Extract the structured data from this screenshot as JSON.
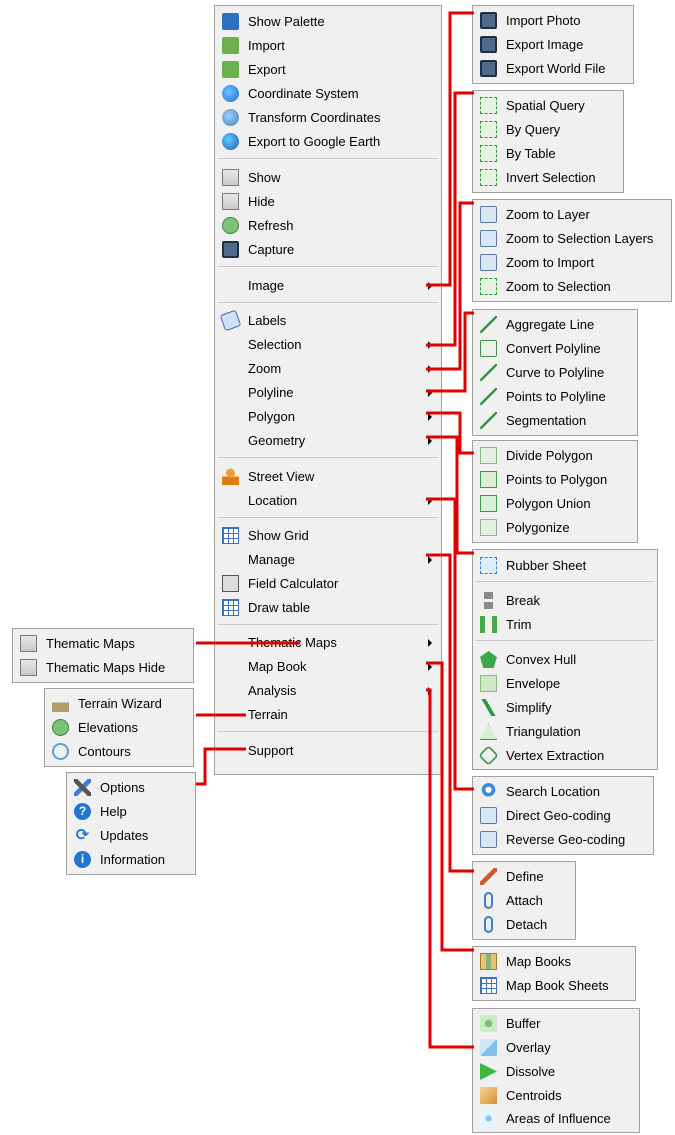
{
  "main_menu": {
    "group1": [
      {
        "label": "Show Palette",
        "icon": "palette-icon"
      },
      {
        "label": "Import",
        "icon": "import-icon"
      },
      {
        "label": "Export",
        "icon": "export-icon"
      },
      {
        "label": "Coordinate System",
        "icon": "globe-icon"
      },
      {
        "label": "Transform Coordinates",
        "icon": "transform-globe-icon"
      },
      {
        "label": "Export to Google Earth",
        "icon": "google-earth-icon"
      }
    ],
    "group2": [
      {
        "label": "Show",
        "icon": "show-icon"
      },
      {
        "label": "Hide",
        "icon": "hide-icon"
      },
      {
        "label": "Refresh",
        "icon": "refresh-icon"
      },
      {
        "label": "Capture",
        "icon": "camera-icon"
      }
    ],
    "group3": [
      {
        "label": "Image"
      }
    ],
    "group4": [
      {
        "label": "Labels",
        "icon": "labels-icon"
      },
      {
        "label": "Selection"
      },
      {
        "label": "Zoom"
      },
      {
        "label": "Polyline"
      },
      {
        "label": "Polygon"
      },
      {
        "label": "Geometry"
      }
    ],
    "group5": [
      {
        "label": "Street View",
        "icon": "street-view-icon"
      },
      {
        "label": "Location"
      }
    ],
    "group6": [
      {
        "label": "Show Grid",
        "icon": "grid-icon"
      },
      {
        "label": "Manage"
      },
      {
        "label": "Field Calculator",
        "icon": "calculator-icon"
      },
      {
        "label": "Draw table",
        "icon": "draw-table-icon"
      }
    ],
    "group7": [
      {
        "label": "Thematic Maps"
      },
      {
        "label": "Map Book"
      },
      {
        "label": "Analysis"
      },
      {
        "label": "Terrain"
      }
    ],
    "group8": [
      {
        "label": "Support"
      }
    ]
  },
  "submenus": {
    "image": [
      {
        "label": "Import Photo",
        "icon": "import-photo-icon"
      },
      {
        "label": "Export Image",
        "icon": "export-image-icon"
      },
      {
        "label": "Export World File",
        "icon": "export-world-file-icon"
      }
    ],
    "selection": [
      {
        "label": "Spatial Query",
        "icon": "spatial-query-icon"
      },
      {
        "label": "By Query",
        "icon": "by-query-icon"
      },
      {
        "label": "By Table",
        "icon": "by-table-icon"
      },
      {
        "label": "Invert Selection",
        "icon": "invert-selection-icon"
      }
    ],
    "zoom": [
      {
        "label": "Zoom to Layer",
        "icon": "zoom-layer-icon"
      },
      {
        "label": "Zoom to Selection Layers",
        "icon": "zoom-selection-layers-icon"
      },
      {
        "label": "Zoom to Import",
        "icon": "zoom-import-icon"
      },
      {
        "label": "Zoom to Selection",
        "icon": "zoom-selection-icon"
      }
    ],
    "polyline": [
      {
        "label": "Aggregate Line",
        "icon": "aggregate-line-icon"
      },
      {
        "label": "Convert Polyline",
        "icon": "convert-2d-3d-icon"
      },
      {
        "label": "Curve to Polyline",
        "icon": "curve-icon"
      },
      {
        "label": "Points to Polyline",
        "icon": "points-polyline-icon"
      },
      {
        "label": "Segmentation",
        "icon": "segmentation-icon"
      }
    ],
    "polygon": [
      {
        "label": "Divide Polygon",
        "icon": "divide-polygon-icon"
      },
      {
        "label": "Points to Polygon",
        "icon": "points-polygon-icon"
      },
      {
        "label": "Polygon Union",
        "icon": "polygon-union-icon"
      },
      {
        "label": "Polygonize",
        "icon": "polygonize-icon"
      }
    ],
    "geometry_a": [
      {
        "label": "Rubber Sheet",
        "icon": "rubber-sheet-icon"
      }
    ],
    "geometry_b": [
      {
        "label": "Break",
        "icon": "break-icon"
      },
      {
        "label": "Trim",
        "icon": "trim-icon"
      }
    ],
    "geometry_c": [
      {
        "label": "Convex Hull",
        "icon": "convex-hull-icon"
      },
      {
        "label": "Envelope",
        "icon": "envelope-icon"
      },
      {
        "label": "Simplify",
        "icon": "simplify-icon"
      },
      {
        "label": "Triangulation",
        "icon": "triangulation-icon"
      },
      {
        "label": "Vertex Extraction",
        "icon": "vertex-extraction-icon"
      }
    ],
    "location": [
      {
        "label": "Search Location",
        "icon": "search-location-icon"
      },
      {
        "label": "Direct Geo-coding",
        "icon": "direct-geocoding-icon"
      },
      {
        "label": "Reverse Geo-coding",
        "icon": "reverse-geocoding-icon"
      }
    ],
    "manage": [
      {
        "label": "Define",
        "icon": "pencil-icon"
      },
      {
        "label": "Attach",
        "icon": "paperclip-icon"
      },
      {
        "label": "Detach",
        "icon": "detach-icon"
      }
    ],
    "map_book": [
      {
        "label": "Map Books",
        "icon": "map-books-icon"
      },
      {
        "label": "Map Book Sheets",
        "icon": "map-book-sheets-icon"
      }
    ],
    "analysis": [
      {
        "label": "Buffer",
        "icon": "buffer-icon"
      },
      {
        "label": "Overlay",
        "icon": "overlay-icon"
      },
      {
        "label": "Dissolve",
        "icon": "dissolve-icon"
      },
      {
        "label": "Centroids",
        "icon": "centroids-icon"
      },
      {
        "label": "Areas of Influence",
        "icon": "areas-influence-icon"
      }
    ],
    "thematic": [
      {
        "label": "Thematic Maps",
        "icon": "thematic-maps-icon"
      },
      {
        "label": "Thematic Maps Hide",
        "icon": "thematic-maps-hide-icon"
      }
    ],
    "terrain": [
      {
        "label": "Terrain Wizard",
        "icon": "terrain-wizard-icon"
      },
      {
        "label": "Elevations",
        "icon": "elevations-icon"
      },
      {
        "label": "Contours",
        "icon": "contours-icon"
      }
    ],
    "support": [
      {
        "label": "Options",
        "icon": "tools-icon"
      },
      {
        "label": "Help",
        "icon": "help-icon"
      },
      {
        "label": "Updates",
        "icon": "updates-icon"
      },
      {
        "label": "Information",
        "icon": "information-icon"
      }
    ]
  },
  "colors": {
    "connector": "#e00000",
    "menu_bg": "#f0f0f0",
    "menu_border": "#a0a0a0"
  }
}
